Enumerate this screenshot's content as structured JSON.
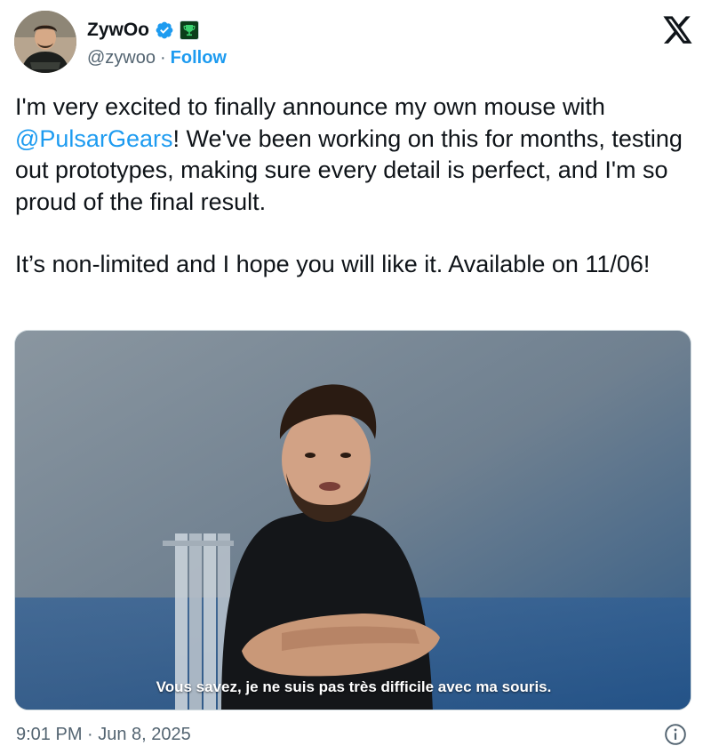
{
  "author": {
    "display_name": "ZywOo",
    "handle": "@zywoo",
    "separator": "·",
    "follow_label": "Follow",
    "verified_icon": "verified-badge-icon",
    "affiliation_icon": "trophy-badge-icon",
    "avatar": "avatar-photo"
  },
  "brand_icon": "x-logo-icon",
  "tweet": {
    "line1_prefix": "I'm very excited to finally announce my own mouse with",
    "mention": "@PulsarGears",
    "line1_suffix": "! We've been working on this for months, testing out prototypes, making sure every detail is perfect, and I'm so proud of the final result.",
    "paragraph2": "It’s non-limited and I hope you will like it. Available on 11/06!"
  },
  "media": {
    "subtitle": "Vous savez, je ne suis pas très difficile avec ma souris."
  },
  "footer": {
    "timestamp": "9:01 PM · Jun 8, 2025",
    "info_icon": "info-icon"
  },
  "colors": {
    "link": "#1d9bf0",
    "text": "#0f1419",
    "muted": "#536471"
  }
}
